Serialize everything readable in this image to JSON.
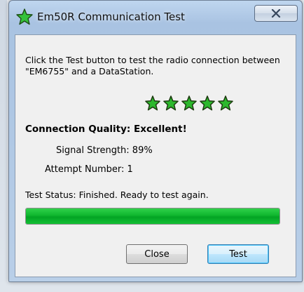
{
  "window": {
    "title": "Em50R Communication Test",
    "icon": "green-star-icon"
  },
  "instructions": "Click the Test button to test the radio connection between \"EM6755\" and a DataStation.",
  "quality": {
    "star_count": 5,
    "star_color": "#2db82d",
    "label": "Connection Quality: Excellent!"
  },
  "signal_strength": "Signal Strength: 89%",
  "attempt_number": "Attempt Number: 1",
  "status": "Test Status: Finished. Ready to test again.",
  "progress": {
    "value": 1.0,
    "color": "#0fb62e"
  },
  "buttons": {
    "close": "Close",
    "test": "Test"
  }
}
